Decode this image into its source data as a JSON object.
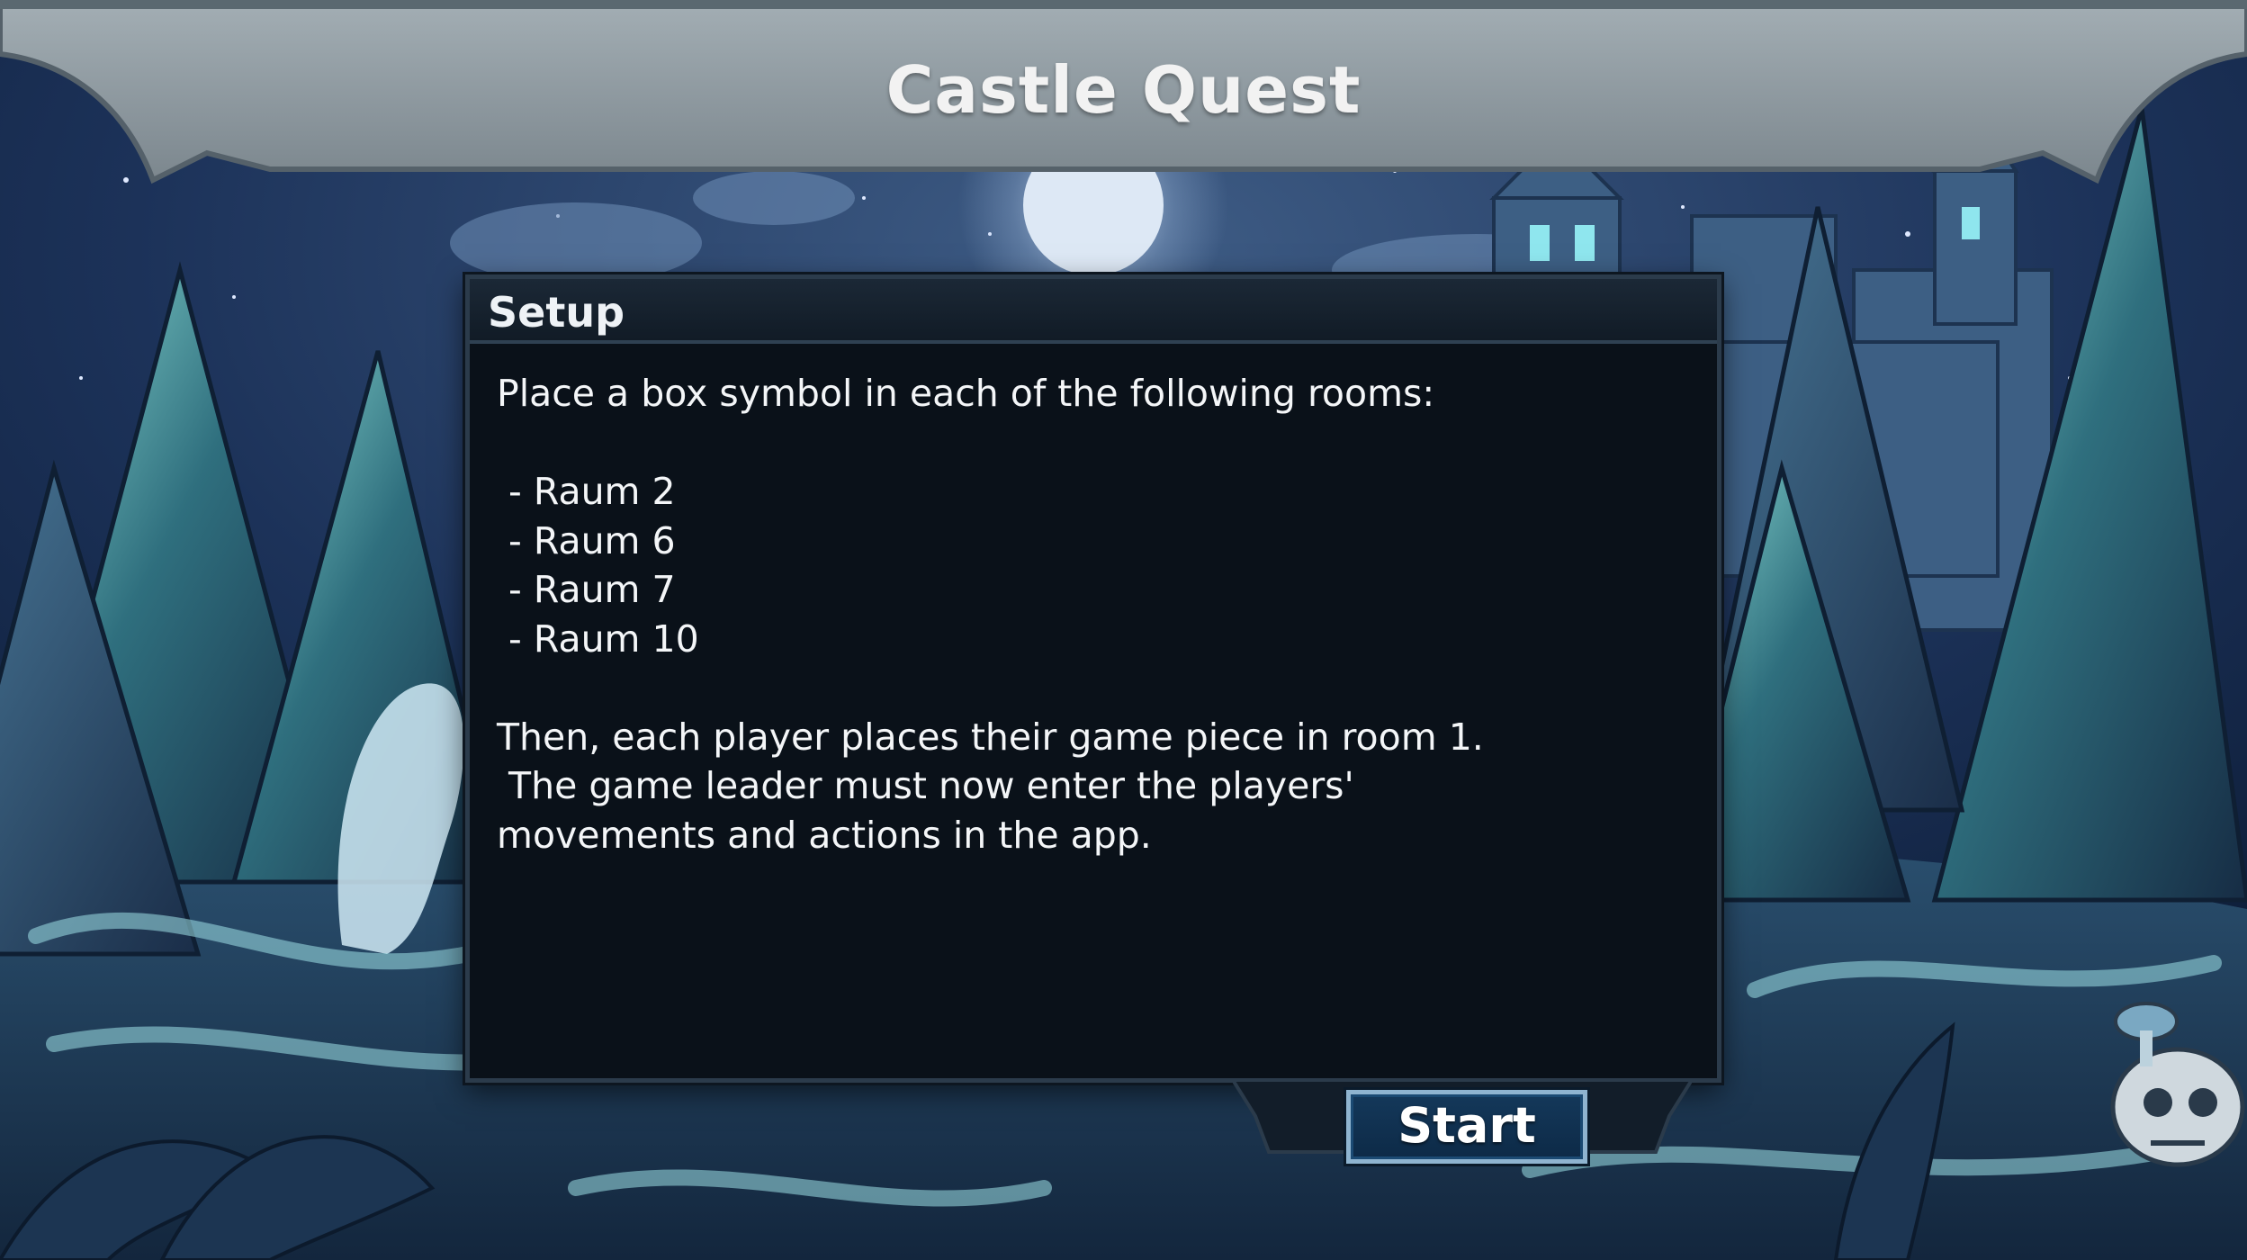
{
  "game": {
    "title": "Castle Quest"
  },
  "setup_panel": {
    "title": "Setup",
    "lines": [
      "Place a box symbol in each of the following rooms:",
      "",
      " - Raum 2",
      " - Raum 6",
      " - Raum 7",
      " - Raum 10",
      "",
      "Then, each player places their game piece in room 1.",
      " The game leader must now enter the players'",
      "movements and actions in the app."
    ]
  },
  "buttons": {
    "start_label": "Start"
  },
  "colors": {
    "banner": "#8e999f",
    "panel_background": "#0a1119",
    "button_background": "#0d2a47",
    "button_border": "#8fb4d0",
    "text": "#f4f6f8"
  }
}
